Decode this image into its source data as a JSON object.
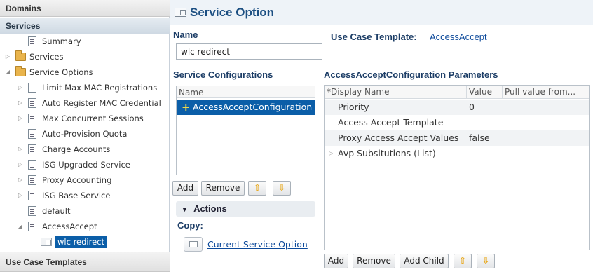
{
  "nav": {
    "domains_label": "Domains",
    "services_label": "Services",
    "use_case_templates_label": "Use Case Templates",
    "tree": [
      {
        "label": "Summary",
        "icon": "summary-doc-icon",
        "indent": 1,
        "twisty": ""
      },
      {
        "label": "Services",
        "icon": "folder-icon",
        "indent": 0,
        "twisty": "▷"
      },
      {
        "label": "Service Options",
        "icon": "folder-icon",
        "indent": 0,
        "twisty": "◢"
      },
      {
        "label": "Limit Max MAC Registrations",
        "icon": "doc-icon",
        "indent": 1,
        "twisty": "▷"
      },
      {
        "label": "Auto Register MAC Credential",
        "icon": "doc-icon",
        "indent": 1,
        "twisty": "▷"
      },
      {
        "label": "Max Concurrent Sessions",
        "icon": "doc-icon",
        "indent": 1,
        "twisty": "▷"
      },
      {
        "label": "Auto-Provision Quota",
        "icon": "doc-icon",
        "indent": 1,
        "twisty": ""
      },
      {
        "label": "Charge Accounts",
        "icon": "doc-icon",
        "indent": 1,
        "twisty": "▷"
      },
      {
        "label": "ISG Upgraded Service",
        "icon": "doc-icon",
        "indent": 1,
        "twisty": "▷"
      },
      {
        "label": "Proxy Accounting",
        "icon": "doc-icon",
        "indent": 1,
        "twisty": "▷"
      },
      {
        "label": "ISG Base Service",
        "icon": "doc-icon",
        "indent": 1,
        "twisty": "▷"
      },
      {
        "label": "default",
        "icon": "doc-icon",
        "indent": 1,
        "twisty": ""
      },
      {
        "label": "AccessAccept",
        "icon": "doc-icon",
        "indent": 1,
        "twisty": "◢"
      },
      {
        "label": "wlc redirect",
        "icon": "service-option-icon",
        "indent": 2,
        "twisty": "",
        "selected": true
      }
    ]
  },
  "main": {
    "title": "Service Option",
    "name_label": "Name",
    "name_value": "wlc redirect",
    "use_case_template_label": "Use Case Template:",
    "use_case_template_value": "AccessAccept",
    "service_configurations_label": "Service Configurations",
    "config_list_header": "Name",
    "config_item": "AccessAcceptConfiguration",
    "config_buttons": {
      "add": "Add",
      "remove": "Remove",
      "up": "⇧",
      "down": "⇩"
    },
    "actions_label": "Actions",
    "actions_toggle": "▼",
    "copy_label": "Copy:",
    "copy_link": "Current Service Option",
    "params_label": "AccessAcceptConfiguration Parameters",
    "params_headers": [
      "*Display Name",
      "Value",
      "Pull value from..."
    ],
    "params_rows": [
      {
        "name": "Priority",
        "value": "0",
        "twisty": ""
      },
      {
        "name": "Access Accept Template",
        "value": "",
        "twisty": ""
      },
      {
        "name": "Proxy Access Accept Values",
        "value": "false",
        "twisty": ""
      },
      {
        "name": "Avp Subsitutions (List)",
        "value": "",
        "twisty": "▷"
      }
    ],
    "params_buttons": {
      "add": "Add",
      "remove": "Remove",
      "add_child": "Add Child",
      "up": "⇧",
      "down": "⇩"
    }
  },
  "colors": {
    "selection": "#0b5ea8",
    "title": "#1c4f82",
    "link": "#0d4a9b"
  }
}
